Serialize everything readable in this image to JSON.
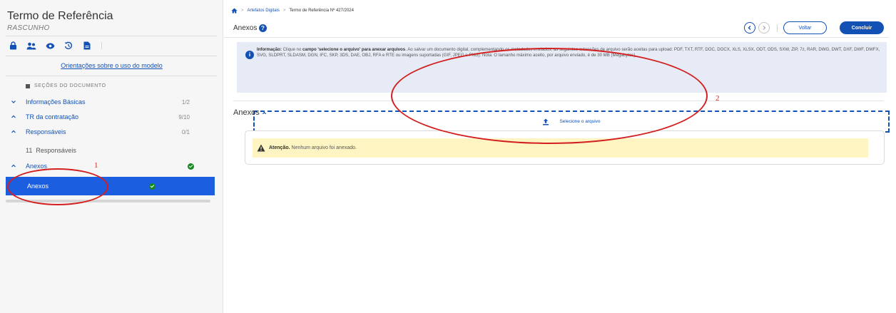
{
  "sidebar": {
    "title": "Termo de Referência",
    "status": "RASCUNHO",
    "toolbar_icons": [
      "lock-icon",
      "users-icon",
      "eye-icon",
      "history-icon",
      "document-icon"
    ],
    "guide_link": "Orientações sobre o uso do modelo",
    "sections_label": "SEÇÕES DO DOCUMENTO",
    "items": [
      {
        "label": "Informações Básicas",
        "count": "1/2",
        "expanded": false
      },
      {
        "label": "TR da contratação",
        "count": "9/10",
        "expanded": true
      },
      {
        "label": "Responsáveis",
        "count": "0/1",
        "expanded": true
      },
      {
        "label": "Anexos",
        "count": "",
        "expanded": true
      }
    ],
    "subitems": {
      "responsaveis": {
        "number": "11",
        "label": "Responsáveis"
      },
      "anexos": {
        "label": "Anexos"
      }
    }
  },
  "breadcrumb": {
    "home_icon": "home-icon",
    "items": [
      "Artefatos Digitais",
      "Termo de Referência Nº 427/2024"
    ]
  },
  "header": {
    "title": "Anexos",
    "back_button": "Voltar",
    "finish_button": "Concluir"
  },
  "info": {
    "label": "Informação:",
    "text_1": "Clique no",
    "bold_1": "campo 'selecione o arquivo' para anexar arquivos",
    "text_2": ". Ao salvar um documento digital, complementando os metadados enviados, as seguintes extensões de arquivo serão aceitas para upload: PDF, TXT, RTF, DOC, DOCX, XLS, XLSX, ODT, ODS, SXW, ZIP, 7z, RAR, DWG, DWT, DXF, DWF, DWFX, SVG, SLDPRT, SLDASM, DGN, IFC, SKP, 3DS, DAE, OBJ, RFA e RTE ou imagens suportadas (GIF, JPEG e PNG). Nota: O tamanho máximo aceito, por arquivo enviado, é de 30 MB (Megabytes)."
  },
  "upload": {
    "label": "Selecione o arquivo"
  },
  "attachments": {
    "title": "Anexos",
    "warning_label": "Atenção.",
    "warning_text": "Nenhum arquivo foi anexado."
  },
  "annotations": {
    "marker_1": "1",
    "marker_2": "2"
  },
  "colors": {
    "primary": "#1351b4",
    "active": "#1b5ee0",
    "success": "#168821",
    "warning_bg": "#fff5c2",
    "annotation": "#d31f1f"
  }
}
